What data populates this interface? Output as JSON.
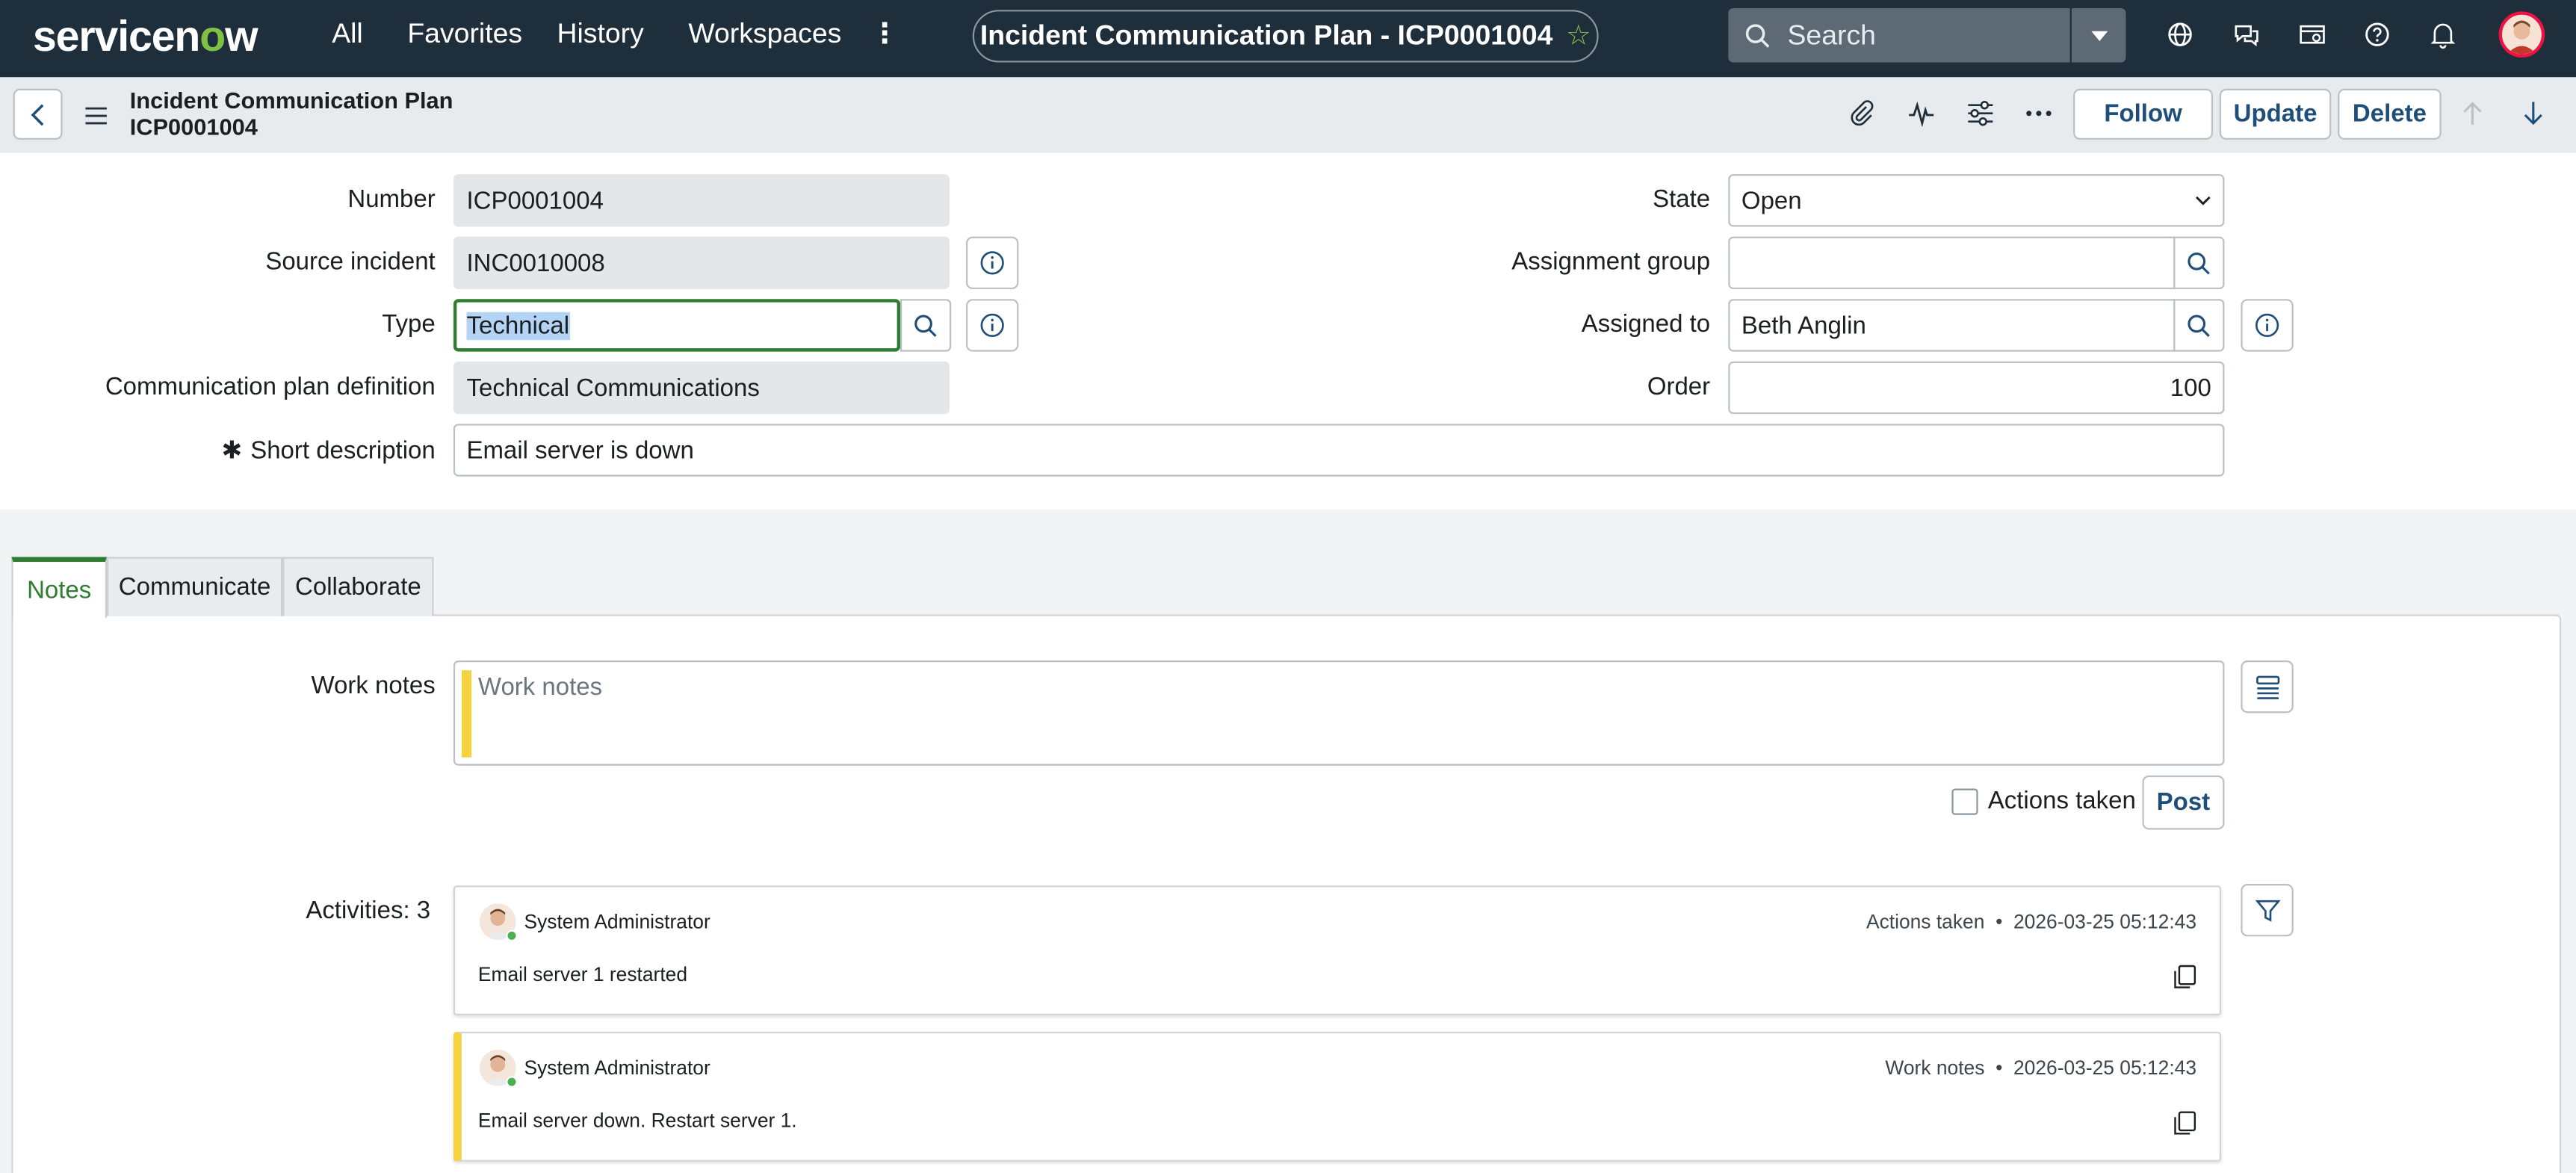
{
  "topnav": {
    "logo_main": "servicen",
    "logo_o": "o",
    "logo_end": "w",
    "items": [
      "All",
      "Favorites",
      "History",
      "Workspaces"
    ],
    "more": "⋮",
    "title": "Incident Communication Plan - ICP0001004",
    "search_placeholder": "Search"
  },
  "record": {
    "title_line1": "Incident Communication Plan",
    "title_line2": "ICP0001004",
    "buttons": {
      "follow": "Follow",
      "update": "Update",
      "delete": "Delete"
    }
  },
  "form": {
    "number": {
      "label": "Number",
      "value": "ICP0001004"
    },
    "source_incident": {
      "label": "Source incident",
      "value": "INC0010008"
    },
    "type": {
      "label": "Type",
      "value": "Technical"
    },
    "plan_definition": {
      "label": "Communication plan definition",
      "value": "Technical Communications"
    },
    "short_description": {
      "label": "Short description",
      "value": "Email server is down",
      "required_mark": "✱"
    },
    "state": {
      "label": "State",
      "value": "Open"
    },
    "assignment_group": {
      "label": "Assignment group",
      "value": ""
    },
    "assigned_to": {
      "label": "Assigned to",
      "value": "Beth Anglin"
    },
    "order": {
      "label": "Order",
      "value": "100"
    }
  },
  "tabs": [
    {
      "label": "Notes",
      "active": true
    },
    {
      "label": "Communicate",
      "active": false
    },
    {
      "label": "Collaborate",
      "active": false
    }
  ],
  "notes": {
    "work_notes_label": "Work notes",
    "work_notes_placeholder": "Work notes",
    "actions_taken_label": "Actions taken",
    "post_label": "Post",
    "activities_label": "Activities: 3"
  },
  "activities": [
    {
      "user": "System Administrator",
      "type": "Actions taken",
      "time": "2026-03-25 05:12:43",
      "message": "Email server 1 restarted"
    },
    {
      "user": "System Administrator",
      "type": "Work notes",
      "time": "2026-03-25 05:12:43",
      "message": "Email server down. Restart server 1."
    }
  ],
  "colors": {
    "nav_bg": "#1f2e3b",
    "accent_green": "#2e7d32",
    "worknote_yellow": "#f5d33f",
    "link_blue": "#1f4e79"
  }
}
